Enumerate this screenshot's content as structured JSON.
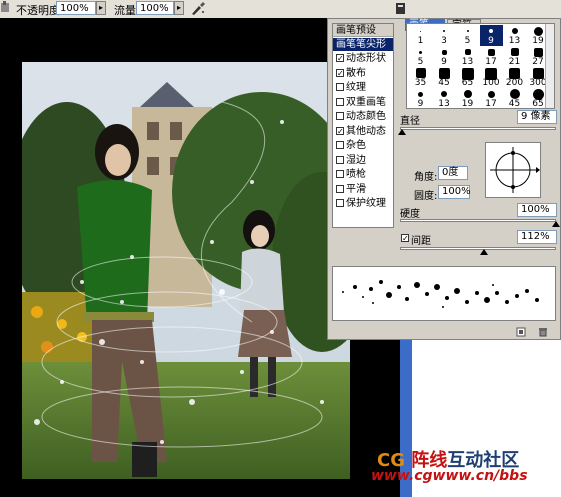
{
  "options_bar": {
    "opacity_label": "不透明度:",
    "opacity_value": "100%",
    "flow_label": "流量:",
    "flow_value": "100%",
    "airbrush_icon": "airbrush-icon"
  },
  "panel": {
    "tabs": [
      {
        "label": "画笔"
      },
      {
        "label": "字符"
      }
    ],
    "list": {
      "header": "画笔预设",
      "selected": "画笔笔尖形状",
      "items": [
        {
          "label": "动态形状",
          "checked": true
        },
        {
          "label": "散布",
          "checked": true
        },
        {
          "label": "纹理",
          "checked": false
        },
        {
          "label": "双重画笔",
          "checked": false
        },
        {
          "label": "动态颜色",
          "checked": false
        },
        {
          "label": "其他动态",
          "checked": true
        },
        {
          "label": "杂色",
          "checked": false
        },
        {
          "label": "湿边",
          "checked": false
        },
        {
          "label": "喷枪",
          "checked": false
        },
        {
          "label": "平滑",
          "checked": false
        },
        {
          "label": "保护纹理",
          "checked": false
        }
      ]
    },
    "brush_tips": [
      {
        "size": "1",
        "d": 1
      },
      {
        "size": "3",
        "d": 2
      },
      {
        "size": "5",
        "d": 2
      },
      {
        "size": "9",
        "d": 4
      },
      {
        "size": "13",
        "d": 6
      },
      {
        "size": "19",
        "d": 9
      },
      {
        "size": "5",
        "d": 3
      },
      {
        "size": "9",
        "d": 5
      },
      {
        "size": "13",
        "d": 6
      },
      {
        "size": "17",
        "d": 7
      },
      {
        "size": "21",
        "d": 8
      },
      {
        "size": "27",
        "d": 9
      },
      {
        "size": "35",
        "d": 10
      },
      {
        "size": "45",
        "d": 11
      },
      {
        "size": "65",
        "d": 12
      },
      {
        "size": "100",
        "d": 12
      },
      {
        "size": "200",
        "d": 11
      },
      {
        "size": "300",
        "d": 11
      },
      {
        "size": "9",
        "d": 5
      },
      {
        "size": "13",
        "d": 6
      },
      {
        "size": "19",
        "d": 8
      },
      {
        "size": "17",
        "d": 7
      },
      {
        "size": "45",
        "d": 10
      },
      {
        "size": "65",
        "d": 11
      }
    ],
    "diameter_label": "直径",
    "diameter_value": "9 像素",
    "angle_label": "角度:",
    "angle_value": "0度",
    "roundness_label": "圆度:",
    "roundness_value": "100%",
    "hardness_label": "硬度",
    "hardness_value": "100%",
    "spacing_label": "间距",
    "spacing_value": "112%",
    "spacing_checked": true
  },
  "watermark": {
    "line1_a": "CG",
    "line1_b": "阵线",
    "line1_c": "互动社区",
    "line2": "www.cgwww.cn/bbs",
    "colors": {
      "dark": "#1f3f73",
      "red": "#c41111",
      "orange": "#e08a10"
    }
  }
}
